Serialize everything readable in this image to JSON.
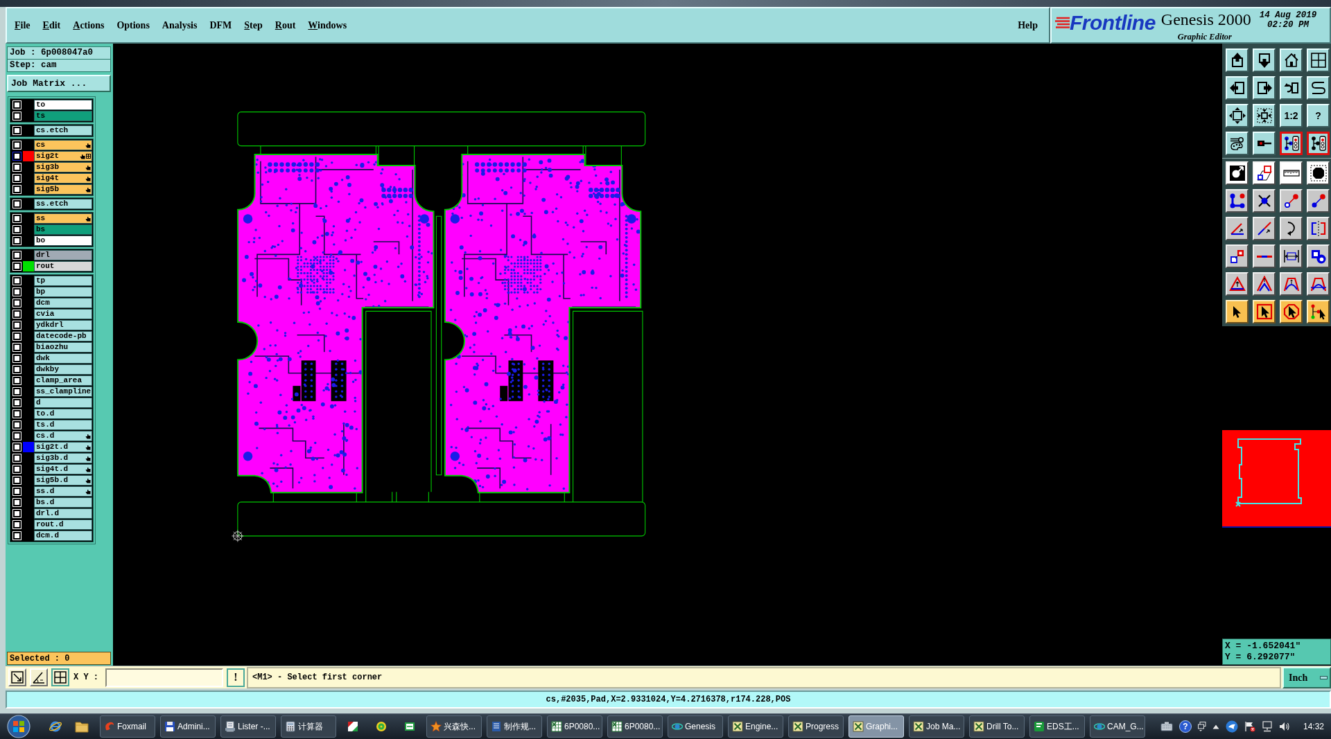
{
  "menu_bar": {
    "items": [
      {
        "label": "File",
        "mnemonic": true
      },
      {
        "label": "Edit",
        "mnemonic": true
      },
      {
        "label": "Actions",
        "mnemonic": true
      },
      {
        "label": "Options",
        "mnemonic": false
      },
      {
        "label": "Analysis",
        "mnemonic": false
      },
      {
        "label": "DFM",
        "mnemonic": false
      },
      {
        "label": "Step",
        "mnemonic": true
      },
      {
        "label": "Rout",
        "mnemonic": true
      },
      {
        "label": "Windows",
        "mnemonic": true
      }
    ],
    "help": {
      "label": "Help",
      "mnemonic": false
    }
  },
  "logo": {
    "brand": "Frontline",
    "product": "Genesis 2000",
    "subtitle": "Graphic Editor",
    "date": "14 Aug 2019",
    "time": "02:20 PM"
  },
  "job_info": {
    "job": "Job : 6p008047a0",
    "step": "Step: cam",
    "matrix_button": "Job Matrix ..."
  },
  "layer_groups": [
    {
      "layers": [
        {
          "name": "to",
          "kind": "silk_screen",
          "checked": false,
          "hand": false,
          "work": false
        },
        {
          "name": "ts",
          "kind": "solder_mask",
          "checked": false,
          "hand": false,
          "work": false
        }
      ]
    },
    {
      "layers": [
        {
          "name": "cs.etch",
          "kind": "misc",
          "checked": false,
          "hand": false,
          "work": false
        }
      ]
    },
    {
      "layers": [
        {
          "name": "cs",
          "kind": "signal",
          "checked": false,
          "hand": true,
          "work": false
        },
        {
          "name": "sig2t",
          "kind": "signal",
          "checked": false,
          "hand": true,
          "work": true,
          "color": "#ff0000"
        },
        {
          "name": "sig3b",
          "kind": "signal",
          "checked": false,
          "hand": true,
          "work": false
        },
        {
          "name": "sig4t",
          "kind": "signal",
          "checked": false,
          "hand": true,
          "work": false
        },
        {
          "name": "sig5b",
          "kind": "signal",
          "checked": false,
          "hand": true,
          "work": false
        }
      ]
    },
    {
      "layers": [
        {
          "name": "ss.etch",
          "kind": "misc",
          "checked": false,
          "hand": false,
          "work": false
        }
      ]
    },
    {
      "layers": [
        {
          "name": "ss",
          "kind": "signal",
          "checked": false,
          "hand": true,
          "work": false
        },
        {
          "name": "bs",
          "kind": "solder_mask",
          "checked": false,
          "hand": false,
          "work": false
        },
        {
          "name": "bo",
          "kind": "silk_screen",
          "checked": false,
          "hand": false,
          "work": false
        }
      ]
    },
    {
      "layers": [
        {
          "name": "drl",
          "kind": "drill",
          "checked": false,
          "hand": false,
          "work": false
        },
        {
          "name": "rout",
          "kind": "rout",
          "checked": false,
          "hand": false,
          "work": false,
          "color": "#00e000"
        }
      ]
    },
    {
      "layers": [
        {
          "name": "tp",
          "kind": "misc",
          "checked": false,
          "hand": false,
          "work": false
        },
        {
          "name": "bp",
          "kind": "misc",
          "checked": false,
          "hand": false,
          "work": false
        },
        {
          "name": "dcm",
          "kind": "misc",
          "checked": false,
          "hand": false,
          "work": false
        },
        {
          "name": "cvia",
          "kind": "misc",
          "checked": false,
          "hand": false,
          "work": false
        },
        {
          "name": "ydkdrl",
          "kind": "misc",
          "checked": false,
          "hand": false,
          "work": false
        },
        {
          "name": "datecode-pb",
          "kind": "misc",
          "checked": false,
          "hand": false,
          "work": false
        },
        {
          "name": "biaozhu",
          "kind": "misc",
          "checked": false,
          "hand": false,
          "work": false
        },
        {
          "name": "dwk",
          "kind": "misc",
          "checked": false,
          "hand": false,
          "work": false
        },
        {
          "name": "dwkby",
          "kind": "misc",
          "checked": false,
          "hand": false,
          "work": false
        },
        {
          "name": "clamp_area",
          "kind": "misc",
          "checked": false,
          "hand": false,
          "work": false
        },
        {
          "name": "ss_clampline",
          "kind": "misc",
          "checked": false,
          "hand": false,
          "work": false
        },
        {
          "name": "d",
          "kind": "misc",
          "checked": false,
          "hand": false,
          "work": false
        },
        {
          "name": "to.d",
          "kind": "misc",
          "checked": false,
          "hand": false,
          "work": false
        },
        {
          "name": "ts.d",
          "kind": "misc",
          "checked": false,
          "hand": false,
          "work": false
        },
        {
          "name": "cs.d",
          "kind": "misc",
          "checked": false,
          "hand": true,
          "work": false
        },
        {
          "name": "sig2t.d",
          "kind": "misc",
          "checked": false,
          "hand": true,
          "work": false,
          "color": "#0000ff"
        },
        {
          "name": "sig3b.d",
          "kind": "misc",
          "checked": false,
          "hand": true,
          "work": false
        },
        {
          "name": "sig4t.d",
          "kind": "misc",
          "checked": false,
          "hand": true,
          "work": false
        },
        {
          "name": "sig5b.d",
          "kind": "misc",
          "checked": false,
          "hand": true,
          "work": false
        },
        {
          "name": "ss.d",
          "kind": "misc",
          "checked": false,
          "hand": true,
          "work": false
        },
        {
          "name": "bs.d",
          "kind": "misc",
          "checked": false,
          "hand": false,
          "work": false
        },
        {
          "name": "drl.d",
          "kind": "misc",
          "checked": false,
          "hand": false,
          "work": false
        },
        {
          "name": "rout.d",
          "kind": "misc",
          "checked": false,
          "hand": false,
          "work": false
        },
        {
          "name": "dcm.d",
          "kind": "misc",
          "checked": false,
          "hand": false,
          "work": false
        }
      ]
    }
  ],
  "selected_count": "Selected : 0",
  "toolbar": {
    "buttons": [
      {
        "kind": "view",
        "on": false
      },
      {
        "kind": "view",
        "on": false
      },
      {
        "kind": "view",
        "on": false
      },
      {
        "kind": "view",
        "on": false
      },
      {
        "kind": "view",
        "on": false
      },
      {
        "kind": "view",
        "on": false
      },
      {
        "kind": "view",
        "on": false
      },
      {
        "kind": "view",
        "on": false
      },
      {
        "kind": "view",
        "on": false
      },
      {
        "kind": "view",
        "on": false
      },
      {
        "kind": "view",
        "label": "1:2",
        "on": false
      },
      {
        "kind": "view",
        "label": "?",
        "on": false
      },
      {
        "kind": "view",
        "on": false
      },
      {
        "kind": "view",
        "on": false
      },
      {
        "kind": "view",
        "on": true
      },
      {
        "kind": "view",
        "on": true
      },
      {
        "kind": "display",
        "on": false
      },
      {
        "kind": "display",
        "on": false
      },
      {
        "kind": "display",
        "on": false
      },
      {
        "kind": "display",
        "on": false
      },
      {
        "kind": "edit",
        "on": false
      },
      {
        "kind": "edit",
        "on": false
      },
      {
        "kind": "edit",
        "on": false
      },
      {
        "kind": "edit",
        "on": false
      },
      {
        "kind": "edit",
        "on": false
      },
      {
        "kind": "edit",
        "on": false
      },
      {
        "kind": "edit",
        "on": false
      },
      {
        "kind": "edit",
        "on": false
      },
      {
        "kind": "edit",
        "on": false
      },
      {
        "kind": "edit",
        "on": false
      },
      {
        "kind": "edit",
        "on": false
      },
      {
        "kind": "edit",
        "on": false
      },
      {
        "kind": "edit",
        "on": false
      },
      {
        "kind": "edit",
        "on": false
      },
      {
        "kind": "edit",
        "on": false
      },
      {
        "kind": "edit",
        "on": false
      },
      {
        "kind": "select",
        "on": false
      },
      {
        "kind": "select",
        "on": false
      },
      {
        "kind": "select",
        "on": false
      },
      {
        "kind": "select",
        "on": false
      }
    ]
  },
  "coordinates": {
    "x": "X = -1.652041\"",
    "y": "Y = 6.292077\""
  },
  "command_bar": {
    "xy_label": "X Y :",
    "confirm_button": "!",
    "prompt": "<M1> - Select first corner",
    "units": "Inch"
  },
  "status_line": "cs,#2035,Pad,X=2.9331024,Y=4.2716378,r174.228,POS",
  "taskbar": {
    "buttons": [
      {
        "label": "Foxmail",
        "selected": false
      },
      {
        "label": "Admini...",
        "selected": false
      },
      {
        "label": "Lister -...",
        "selected": false
      },
      {
        "label": "计算器",
        "selected": false
      },
      {
        "selected": false
      },
      {
        "selected": false
      },
      {
        "selected": false
      },
      {
        "label": "兴森快...",
        "selected": false
      },
      {
        "label": "制作规...",
        "selected": false
      },
      {
        "label": "6P0080...",
        "selected": false
      },
      {
        "label": "6P0080...",
        "selected": false
      },
      {
        "label": "Genesis",
        "selected": false
      },
      {
        "label": "Engine...",
        "selected": false
      },
      {
        "label": "Progress",
        "selected": false
      },
      {
        "label": "Graphi...",
        "selected": true
      },
      {
        "label": "Job Ma...",
        "selected": false
      },
      {
        "label": "Drill To...",
        "selected": false
      },
      {
        "label": "EDS工...",
        "selected": false
      },
      {
        "label": "CAM_G...",
        "selected": false
      }
    ],
    "help_glyph": "?",
    "clock": "14:32"
  }
}
